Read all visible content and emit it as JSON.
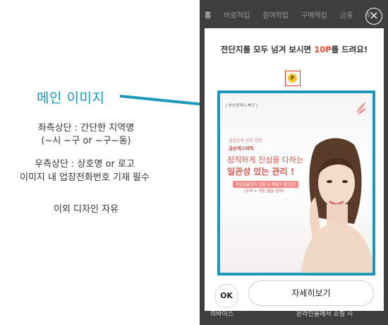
{
  "annotation": {
    "title": "메인 이미지",
    "line1": "좌측상단 : 간단한 지역명",
    "line2": "(~시 ~구 or ~구~동)",
    "line3": "우측상단 : 상호명 or 로고",
    "line4": "이미지 내 업장전화번호 기재 필수",
    "line5": "이외 디자인 자유"
  },
  "tabs": [
    {
      "label": "홈",
      "active": true
    },
    {
      "label": "바로적립",
      "active": false
    },
    {
      "label": "참여적립",
      "active": false
    },
    {
      "label": "구매적립",
      "active": false
    },
    {
      "label": "금융",
      "active": false
    },
    {
      "label": "투",
      "active": false
    }
  ],
  "close_icon": "×",
  "modal": {
    "headline_pre": "전단지를 모두 넘겨 보시면 ",
    "headline_highlight": "10P",
    "headline_post": "를 드려요!",
    "coin_symbol": "P"
  },
  "ad": {
    "region": "[ 부산광역시 북구 ]",
    "sub1": "얼굴윤곽 관리 전문",
    "sub2": "금손에스테틱",
    "main1": "정직하게 진심을 다하는",
    "main2": "일관성 있는 관리 !",
    "badge1": "작은얼굴관리 상담 시 체험가 할인중!",
    "badge2": "(두피 + 작은 얼굴 관리)"
  },
  "buttons": {
    "ok": "OK",
    "detail": "자세히보기"
  },
  "bottom": {
    "left": "리바이스",
    "right": "온라인몰에서 쇼핑 시"
  },
  "colors": {
    "accent": "#1d98b8",
    "highlight": "#e8472a",
    "ad_red": "#d5574f"
  }
}
